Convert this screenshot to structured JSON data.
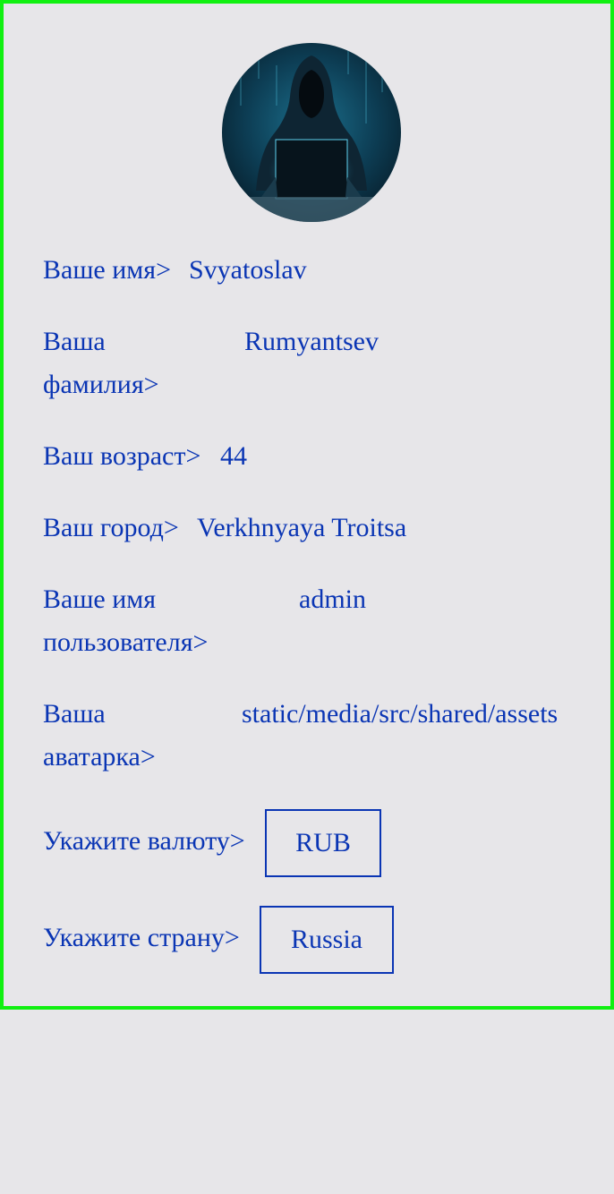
{
  "profile": {
    "avatar_icon": "hacker-avatar-image",
    "fields": {
      "first_name": {
        "label": "Ваше имя>",
        "value": "Svyatoslav"
      },
      "last_name": {
        "label": "Ваша фамилия>",
        "value": "Rumyantsev"
      },
      "age": {
        "label": "Ваш возраст>",
        "value": "44"
      },
      "city": {
        "label": "Ваш город>",
        "value": "Verkhnyaya Troitsa"
      },
      "username": {
        "label": "Ваше имя пользователя>",
        "value": "admin"
      },
      "avatar": {
        "label": "Ваша аватарка>",
        "value": "static/media/src/shared/assets"
      }
    },
    "currency": {
      "label": "Укажите валюту>",
      "selected": "RUB"
    },
    "country": {
      "label": "Укажите страну>",
      "selected": "Russia"
    }
  },
  "colors": {
    "text": "#0a35b4",
    "border": "#11f011",
    "background": "#e7e6e9"
  }
}
